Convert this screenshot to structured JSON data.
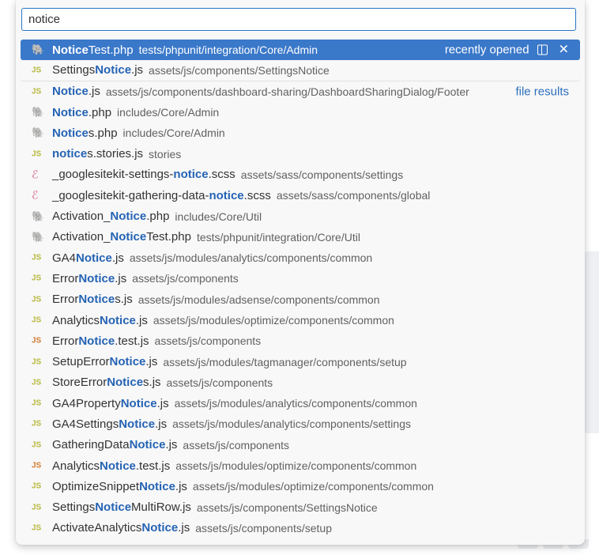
{
  "search": {
    "value": "notice"
  },
  "results": [
    {
      "icon": "php",
      "pre": "",
      "hl": "Notice",
      "post": "Test.php",
      "path": "tests/phpunit/integration/Core/Admin",
      "selected": true,
      "right": "recently opened"
    },
    {
      "icon": "js",
      "pre": "Settings",
      "hl": "Notice",
      "post": ".js",
      "path": "assets/js/components/SettingsNotice",
      "sep": true
    },
    {
      "icon": "js",
      "pre": "",
      "hl": "Notice",
      "post": ".js",
      "path": "assets/js/components/dashboard-sharing/DashboardSharingDialog/Footer",
      "right": "file results"
    },
    {
      "icon": "php",
      "pre": "",
      "hl": "Notice",
      "post": ".php",
      "path": "includes/Core/Admin"
    },
    {
      "icon": "php",
      "pre": "",
      "hl": "Notice",
      "post": "s.php",
      "path": "includes/Core/Admin"
    },
    {
      "icon": "js",
      "pre": "",
      "hl": "notice",
      "post": "s.stories.js",
      "path": "stories"
    },
    {
      "icon": "scss",
      "pre": "_googlesitekit-settings-",
      "hl": "notice",
      "post": ".scss",
      "path": "assets/sass/components/settings"
    },
    {
      "icon": "scss",
      "pre": "_googlesitekit-gathering-data-",
      "hl": "notice",
      "post": ".scss",
      "path": "assets/sass/components/global"
    },
    {
      "icon": "php",
      "pre": "Activation_",
      "hl": "Notice",
      "post": ".php",
      "path": "includes/Core/Util"
    },
    {
      "icon": "php",
      "pre": "Activation_",
      "hl": "Notice",
      "post": "Test.php",
      "path": "tests/phpunit/integration/Core/Util"
    },
    {
      "icon": "js",
      "pre": "GA4",
      "hl": "Notice",
      "post": ".js",
      "path": "assets/js/modules/analytics/components/common"
    },
    {
      "icon": "js",
      "pre": "Error",
      "hl": "Notice",
      "post": ".js",
      "path": "assets/js/components"
    },
    {
      "icon": "js",
      "pre": "Error",
      "hl": "Notice",
      "post": "s.js",
      "path": "assets/js/modules/adsense/components/common"
    },
    {
      "icon": "js",
      "pre": "Analytics",
      "hl": "Notice",
      "post": ".js",
      "path": "assets/js/modules/optimize/components/common"
    },
    {
      "icon": "jstest",
      "pre": "Error",
      "hl": "Notice",
      "post": ".test.js",
      "path": "assets/js/components"
    },
    {
      "icon": "js",
      "pre": "SetupError",
      "hl": "Notice",
      "post": ".js",
      "path": "assets/js/modules/tagmanager/components/setup"
    },
    {
      "icon": "js",
      "pre": "StoreError",
      "hl": "Notice",
      "post": "s.js",
      "path": "assets/js/components"
    },
    {
      "icon": "js",
      "pre": "GA4Property",
      "hl": "Notice",
      "post": ".js",
      "path": "assets/js/modules/analytics/components/common"
    },
    {
      "icon": "js",
      "pre": "GA4Settings",
      "hl": "Notice",
      "post": ".js",
      "path": "assets/js/modules/analytics/components/settings"
    },
    {
      "icon": "js",
      "pre": "GatheringData",
      "hl": "Notice",
      "post": ".js",
      "path": "assets/js/components"
    },
    {
      "icon": "jstest",
      "pre": "Analytics",
      "hl": "Notice",
      "post": ".test.js",
      "path": "assets/js/modules/optimize/components/common"
    },
    {
      "icon": "js",
      "pre": "OptimizeSnippet",
      "hl": "Notice",
      "post": ".js",
      "path": "assets/js/modules/optimize/components/common"
    },
    {
      "icon": "js",
      "pre": "Settings",
      "hl": "Notice",
      "post": "MultiRow.js",
      "path": "assets/js/components/SettingsNotice"
    },
    {
      "icon": "js",
      "pre": "ActivateAnalytics",
      "hl": "Notice",
      "post": ".js",
      "path": "assets/js/components/setup"
    }
  ],
  "icons": {
    "js": {
      "label": "JS",
      "name": "js-file-icon",
      "color": "#b7b73b"
    },
    "jstest": {
      "label": "JS",
      "name": "js-test-file-icon",
      "color": "#d07a2d"
    },
    "php": {
      "label": "🐘",
      "name": "php-elephant-icon",
      "color": "#8c6fc4"
    },
    "scss": {
      "label": "ℰ",
      "name": "sass-file-icon",
      "color": "#d66b8c"
    }
  },
  "actions": {
    "split_icon": "split-editor-icon",
    "close_icon": "close-icon",
    "close_glyph": "✕"
  }
}
